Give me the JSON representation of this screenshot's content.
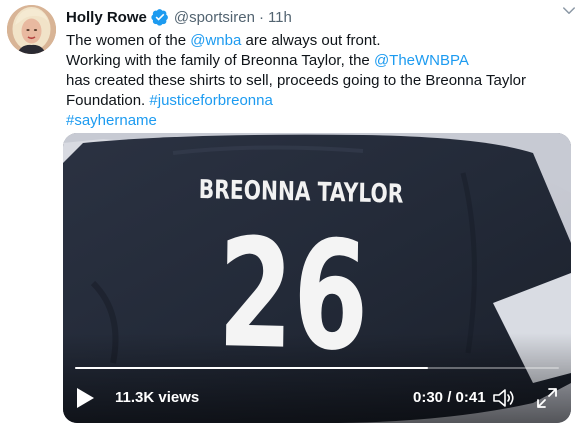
{
  "tweet": {
    "author_name": "Holly Rowe",
    "handle": "@sportsiren",
    "separator": "·",
    "time": "11h",
    "text": {
      "line1_a": "The women of the ",
      "line1_link": "@wnba",
      "line1_b": " are always out front.",
      "line2_a": "Working with the family of Breonna Taylor, the ",
      "line2_link": "@TheWNBPA",
      "line3": "has created these shirts to sell, proceeds going to the Breonna Taylor",
      "line4_a": "Foundation. ",
      "line4_link": "#justiceforbreonna",
      "line5_link": "#sayhername"
    }
  },
  "video": {
    "shirt_name": "BREONNA TAYLOR",
    "shirt_number": "26",
    "views": "11.3K views",
    "timecode": "0:30 / 0:41",
    "progress_fraction": 0.73
  },
  "colors": {
    "link": "#1d9bf0",
    "text": "#0f1419",
    "secondary": "#536471",
    "verified": "#1d9bf0"
  },
  "icons": {
    "verified": "verified-badge-icon",
    "caret": "chevron-down-icon",
    "play": "play-icon",
    "volume": "volume-icon",
    "fullscreen": "fullscreen-icon"
  }
}
